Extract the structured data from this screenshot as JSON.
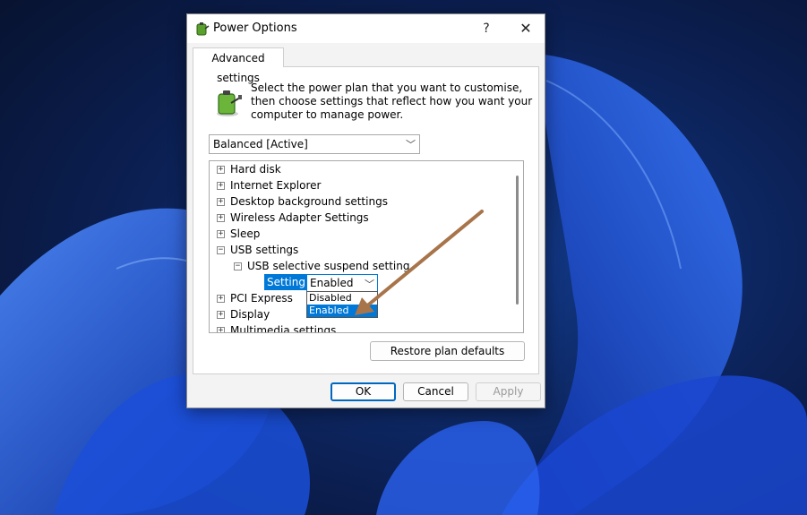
{
  "window": {
    "title": "Power Options",
    "help_glyph": "?",
    "close_glyph": "✕"
  },
  "tab": {
    "label": "Advanced settings"
  },
  "description": "Select the power plan that you want to customise, then choose settings that reflect how you want your computer to manage power.",
  "plan_select": {
    "value": "Balanced [Active]"
  },
  "tree": {
    "items": [
      {
        "label": "Hard disk",
        "state": "+"
      },
      {
        "label": "Internet Explorer",
        "state": "+"
      },
      {
        "label": "Desktop background settings",
        "state": "+"
      },
      {
        "label": "Wireless Adapter Settings",
        "state": "+"
      },
      {
        "label": "Sleep",
        "state": "+"
      },
      {
        "label": "USB settings",
        "state": "−"
      },
      {
        "label": "USB selective suspend setting",
        "state": "−"
      },
      {
        "label": "PCI Express",
        "state": "+"
      },
      {
        "label": "Display",
        "state": "+"
      },
      {
        "label": "Multimedia settings",
        "state": "+"
      }
    ],
    "setting_label": "Setting:",
    "setting_value": "Enabled",
    "options": [
      "Disabled",
      "Enabled"
    ],
    "selected_option": "Enabled"
  },
  "buttons": {
    "restore": "Restore plan defaults",
    "ok": "OK",
    "cancel": "Cancel",
    "apply": "Apply"
  },
  "colors": {
    "accent": "#0078d7",
    "arrow": "#a8744a"
  }
}
